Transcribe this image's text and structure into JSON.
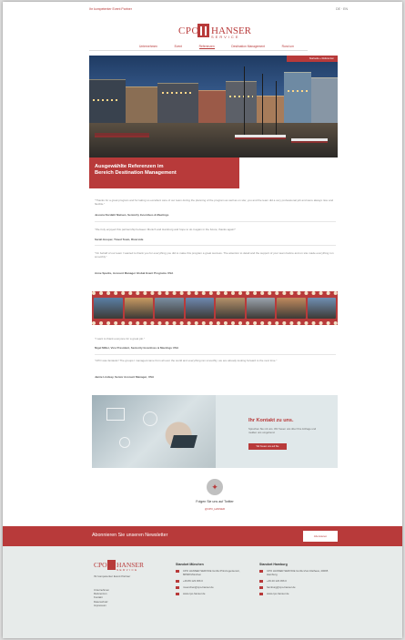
{
  "header": {
    "tagline": "Ihr kompetenter Event Partner",
    "lang": "DE · EN",
    "logo": {
      "left": "CPO",
      "right": "HANSER",
      "sub": "SERVICE"
    }
  },
  "nav": {
    "items": [
      {
        "label": "Unternehmen",
        "active": false
      },
      {
        "label": "Event",
        "active": false
      },
      {
        "label": "Referenzen",
        "active": true
      },
      {
        "label": "Destination Management",
        "active": false
      },
      {
        "label": "Rund um",
        "active": false
      }
    ]
  },
  "hero": {
    "breadcrumb": "Startseite » Referenzen"
  },
  "title": {
    "line1": "Ausgewählte Referenzen im",
    "line2": "Bereich Destination Management"
  },
  "testimonials": [
    {
      "quote": "\"Thanks for a great program and for taking so excellent care of our team during the planning of the program as well as on site; you and the team did a very professional job and were always nice and flexible.\"",
      "author": "Jessica Nordahl Nielsen, Seniority Incentives & Meetings"
    },
    {
      "quote": "\"We truly enjoyed this partnership between Munich and Hamburg and hope to do it again in the future; thanks again!\"",
      "author": "Sarah Hooper, Travel Team, Riverside"
    },
    {
      "quote": "\"On behalf of our team I wanted to thank you for everything you did to make this program a great success. The attention to detail and the support of your team before and on site made everything run smoothly.\"",
      "author": "Anne Sparks, Account Manager Global Event Programs USA"
    },
    {
      "quote": "\"I want to thank everyone for a great job.\"",
      "author": "Nigel Miller, Vice President, Seniority Incentives & Meetings USA"
    },
    {
      "quote": "\"CPO was fantastic! The groups I managed came from all over the world and everything ran smoothly; we are already looking forward to the next time.\"",
      "author": "Jamie Lindsay, Senior Account Manager, USA"
    }
  ],
  "filmstrip": {
    "frames": [
      "#5a7fa6",
      "#c89a62",
      "#7a8ea2",
      "#6d88b0",
      "#b5916a",
      "#9aa3ad",
      "#c08a5e",
      "#6f8fb3"
    ]
  },
  "contact": {
    "title": "Ihr Kontakt zu uns.",
    "text": "Sprechen Sie mit uns. Wir freuen uns über Ihre Anfrage und melden uns umgehend.",
    "button": "Wir freuen uns auf Sie"
  },
  "social": {
    "label": "Folgen Sie uns auf Twitter",
    "sub": "@CPO_HANSER"
  },
  "newsletter": {
    "title": "Abonnieren Sie unseren Newsletter",
    "button": "Abonnieren"
  },
  "footer": {
    "tagline": "Ihr kompetenter Event Partner",
    "links": [
      "Unternehmen",
      "Referenzen",
      "Kontakt",
      "Datenschutz",
      "Impressum"
    ],
    "munich": {
      "heading": "Standort München",
      "address": "CPO HANSER SERVICE GmbH Prinzregentenstr., 80538 München",
      "phone": "+49 89 123 456 0",
      "email": "muenchen@cpo-hanser.de",
      "web": "www.cpo-hanser.de"
    },
    "hamburg": {
      "heading": "Standort Hamburg",
      "address": "CPO HANSER SERVICE GmbH Zum Rathaus, 20095 Hamburg",
      "phone": "+49 40 123 456 0",
      "email": "hamburg@cpo-hanser.de",
      "web": "www.cpo-hanser.de"
    }
  },
  "colors": {
    "accent": "#b83a3a"
  }
}
